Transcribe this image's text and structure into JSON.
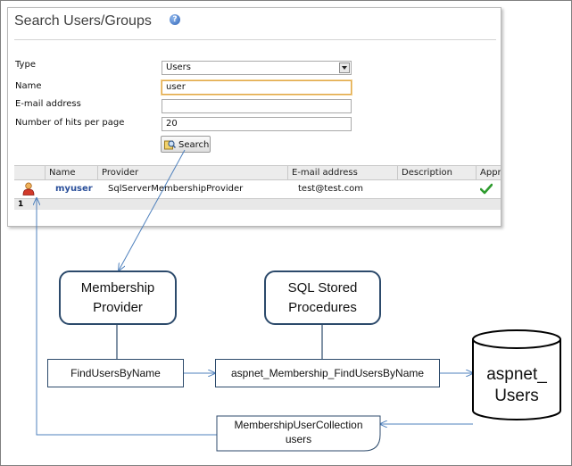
{
  "search_panel": {
    "title": "Search Users/Groups",
    "help_icon": "help-icon",
    "form": {
      "type_label": "Type",
      "type_value": "Users",
      "name_label": "Name",
      "name_value": "user",
      "email_label": "E-mail address",
      "email_value": "",
      "hits_label": "Number of hits per page",
      "hits_value": "20",
      "search_button": "Search"
    },
    "grid": {
      "columns": [
        "Name",
        "Provider",
        "E-mail address",
        "Description",
        "Appro"
      ],
      "rows": [
        {
          "name": "myuser",
          "provider": "SqlServerMembershipProvider",
          "email": "test@test.com",
          "description": "",
          "approved_icon": "check-icon"
        }
      ],
      "page": "1"
    }
  },
  "diagram": {
    "membership_provider": "Membership Provider",
    "sql_procedures": "SQL Stored Procedures",
    "find_users_by_name": "FindUsersByName",
    "aspnet_find": "aspnet_Membership_FindUsersByName",
    "database": "aspnet_ Users",
    "collection_line1": "MembershipUserCollection",
    "collection_line2": "users"
  },
  "colors": {
    "box_border": "#2c4a6b",
    "arrow": "#4f81bd",
    "link": "#2a4f9a",
    "check": "#2e9b2e"
  }
}
